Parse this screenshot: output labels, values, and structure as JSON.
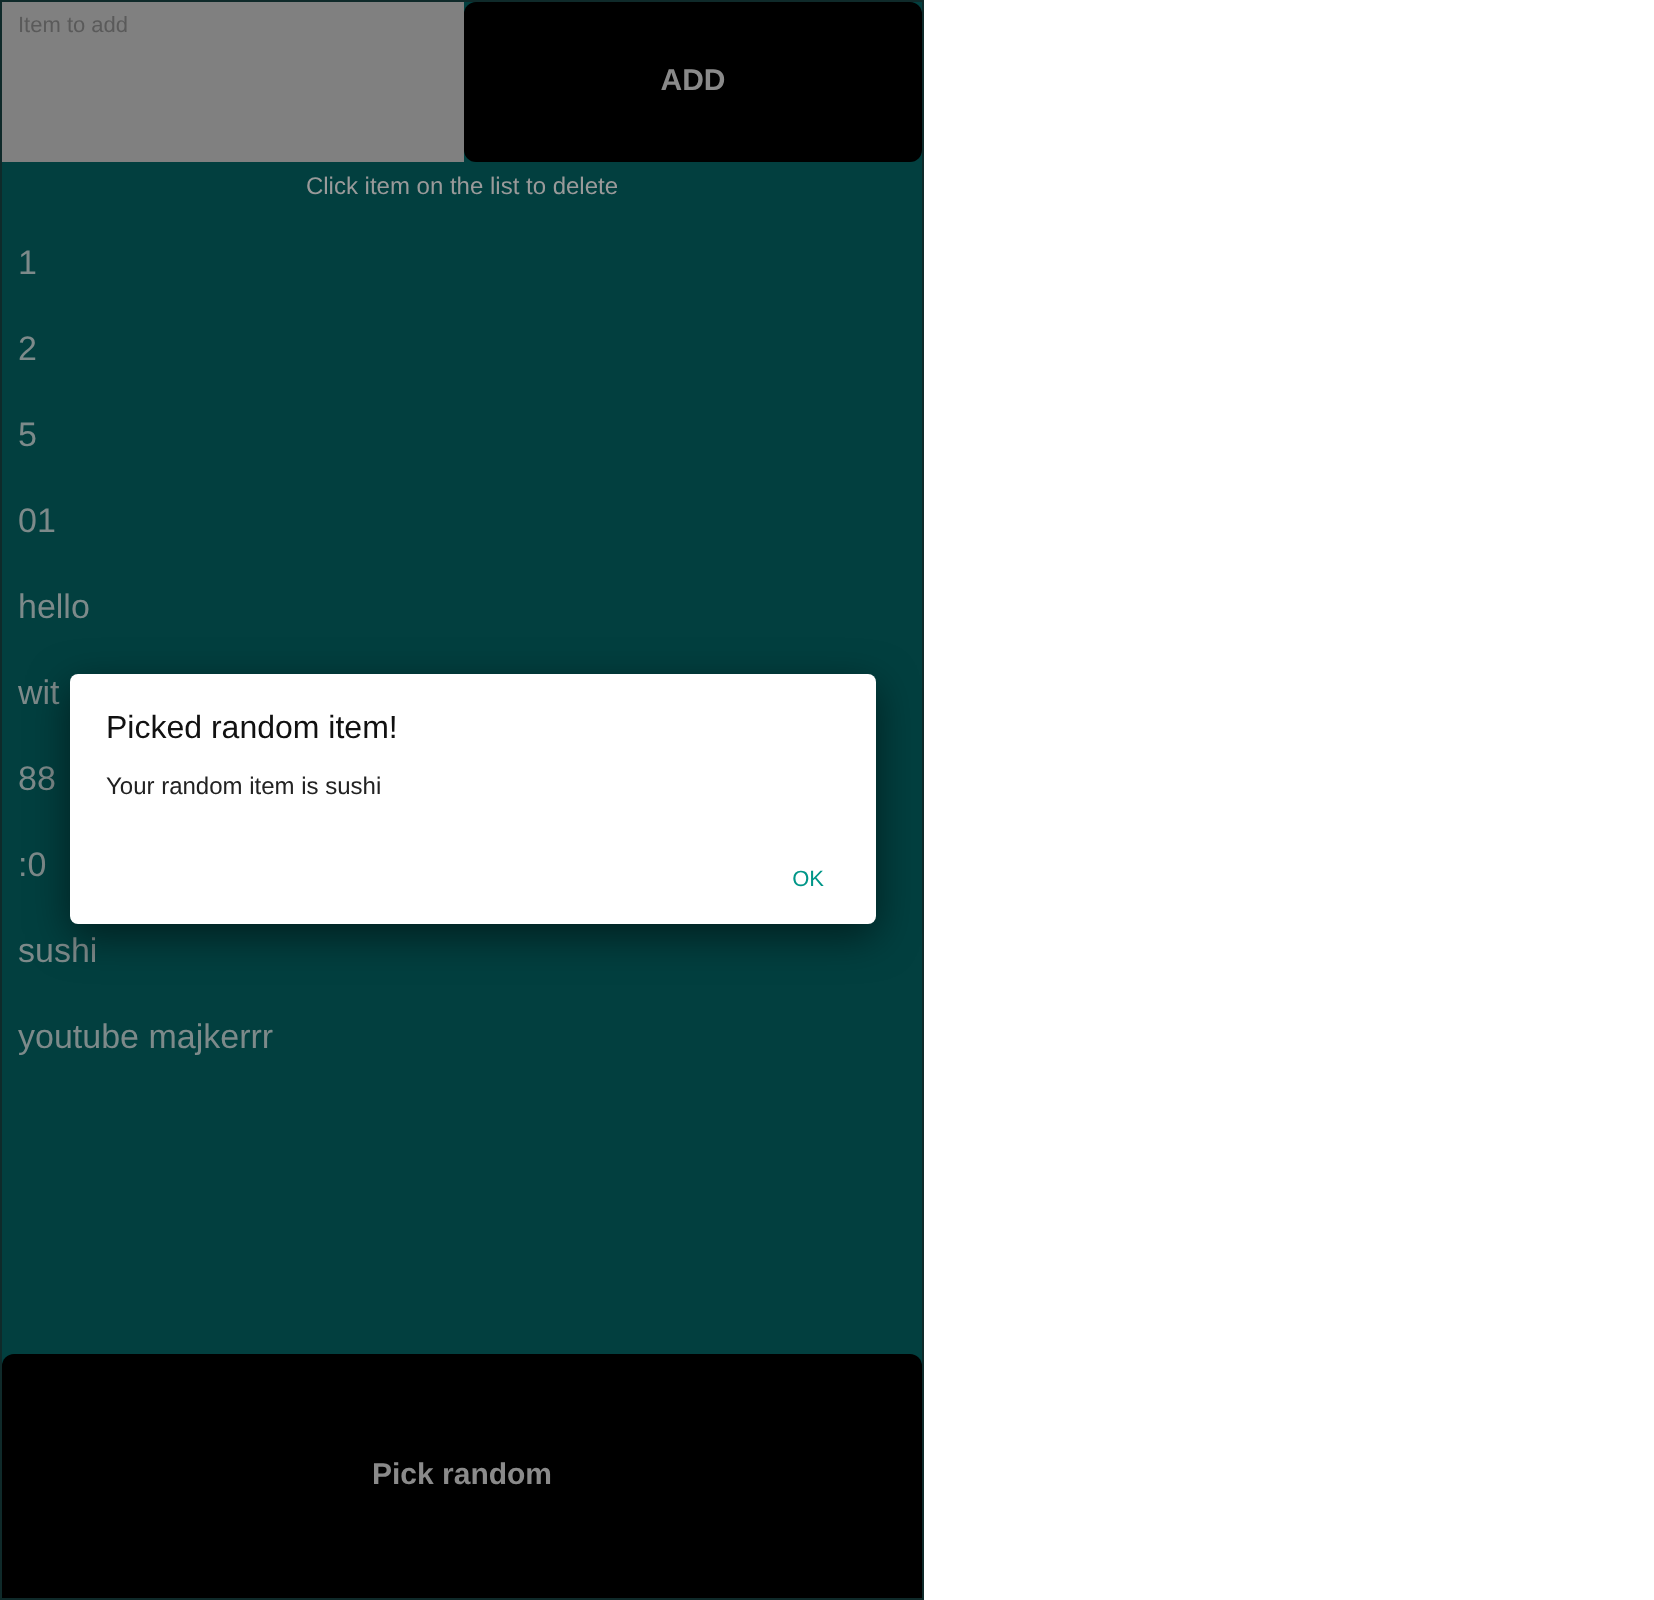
{
  "input": {
    "placeholder": "Item to add"
  },
  "add_button": "ADD",
  "hint": "Click item on the list to delete",
  "items": [
    "1",
    "2",
    "5",
    "01",
    "hello",
    "wit",
    "88",
    ":0",
    "sushi",
    "youtube majkerrr"
  ],
  "pick_button": "Pick random",
  "dialog": {
    "title": "Picked random item!",
    "message": "Your random item is sushi",
    "button": "OK"
  }
}
